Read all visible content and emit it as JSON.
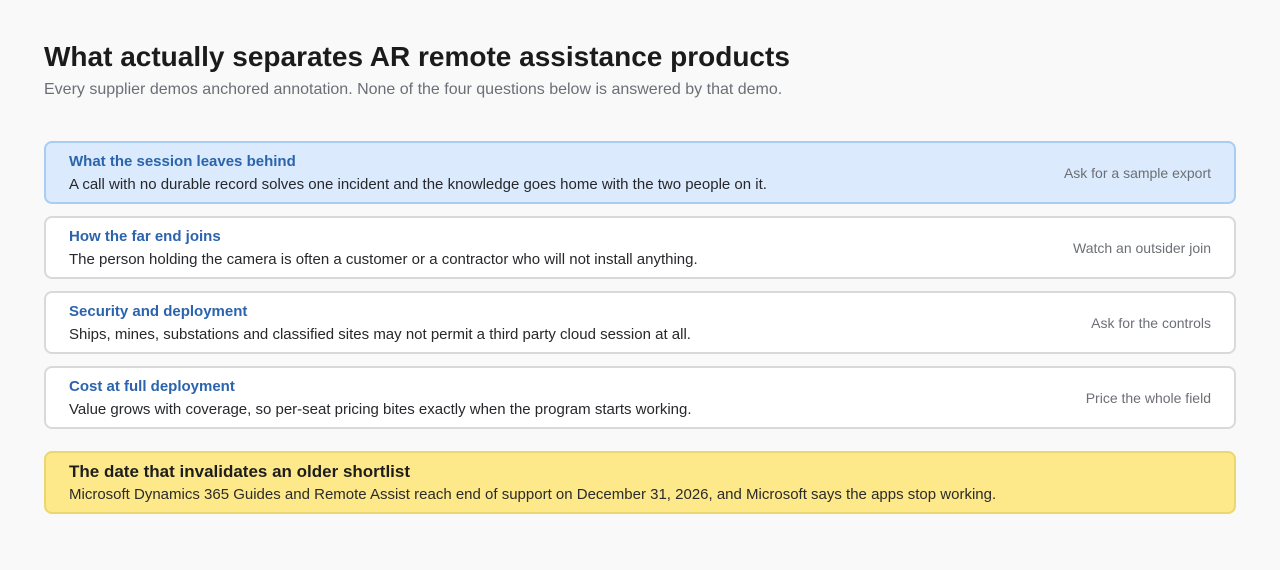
{
  "header": {
    "title": "What actually separates AR remote assistance products",
    "subtitle": "Every supplier demos anchored annotation. None of the four questions below is answered by that demo."
  },
  "questions": [
    {
      "title": "What the session leaves behind",
      "description": "A call with no durable record solves one incident and the knowledge goes home with the two people on it.",
      "action": "Ask for a sample export",
      "active": true
    },
    {
      "title": "How the far end joins",
      "description": "The person holding the camera is often a customer or a contractor who will not install anything.",
      "action": "Watch an outsider join",
      "active": false
    },
    {
      "title": "Security and deployment",
      "description": "Ships, mines, substations and classified sites may not permit a third party cloud session at all.",
      "action": "Ask for the controls",
      "active": false
    },
    {
      "title": "Cost at full deployment",
      "description": "Value grows with coverage, so per-seat pricing bites exactly when the program starts working.",
      "action": "Price the whole field",
      "active": false
    }
  ],
  "notice": {
    "title": "The date that invalidates an older shortlist",
    "body": "Microsoft Dynamics 365 Guides and Remote Assist reach end of support on December 31, 2026, and Microsoft says the apps stop working."
  },
  "colors": {
    "page_background": "#f9f9f9",
    "active_card_background": "#dbeafc",
    "active_card_border": "#a8cdf3",
    "question_title": "#2b64ad",
    "notice_background": "#fde98a"
  }
}
